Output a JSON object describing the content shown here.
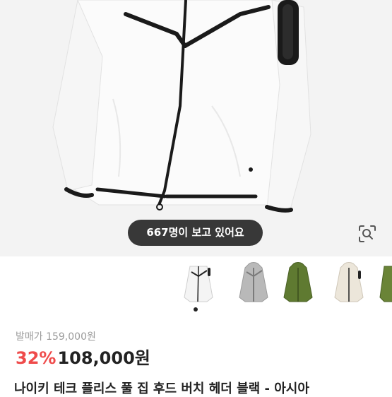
{
  "product": {
    "viewer_count_text": "667명이 보고 있어요",
    "original_price_label": "발매가 159,000원",
    "discount": "32%",
    "sale_price": "108,000원",
    "title": "나이키 테크 플리스 풀 집 후드 버치 헤더 블랙 - 아시아"
  },
  "thumbnails": [
    {
      "name": "white-black",
      "color": "#f4f4f4"
    },
    {
      "name": "grey",
      "color": "#b9b9b9"
    },
    {
      "name": "olive-hood",
      "color": "#5f7a31"
    },
    {
      "name": "birch-heather",
      "color": "#ece6da"
    },
    {
      "name": "olive",
      "color": "#6a8437"
    }
  ],
  "colors": {
    "discount": "#ef4b4b",
    "jacket_trim": "#1a1a1a",
    "pill_bg": "#1e1e1e"
  },
  "icons": [
    "lens-search-icon"
  ]
}
